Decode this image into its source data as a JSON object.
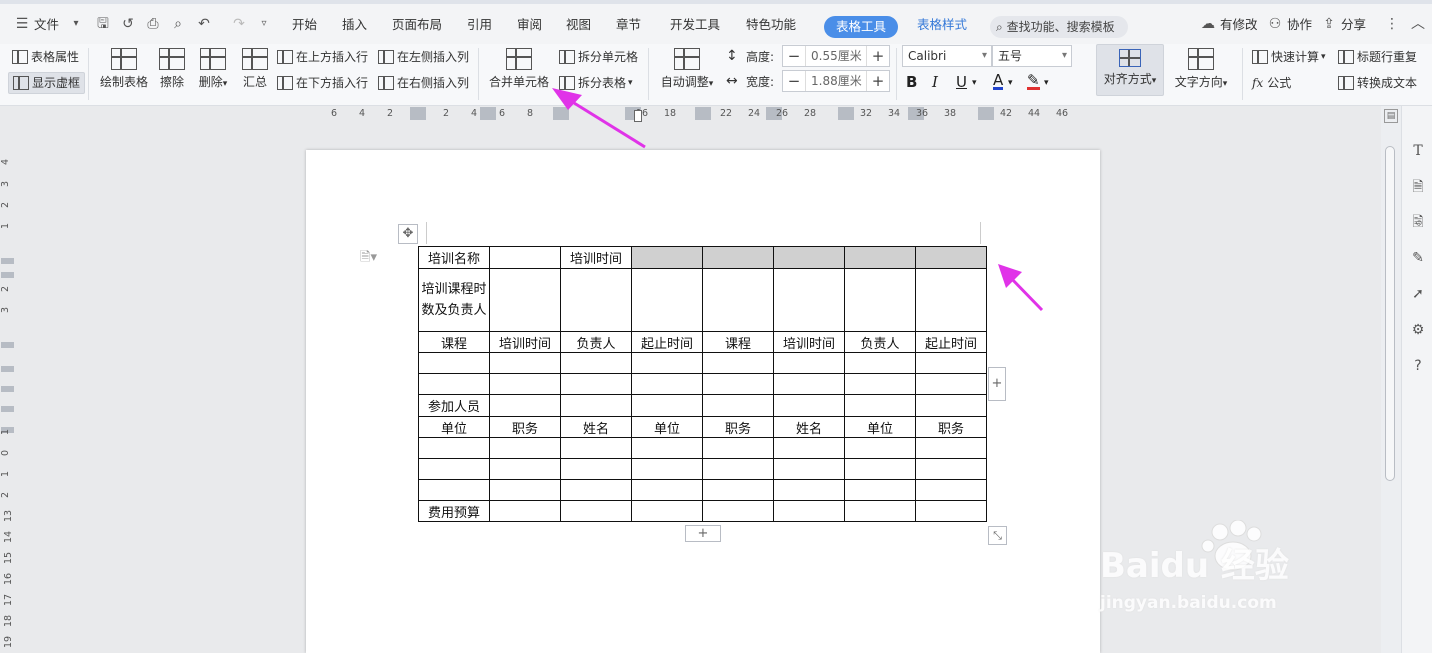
{
  "menubar": {
    "file": "文件",
    "tabs": [
      "开始",
      "插入",
      "页面布局",
      "引用",
      "审阅",
      "视图",
      "章节",
      "开发工具",
      "特色功能"
    ],
    "active_tab": "表格工具",
    "style_tab": "表格样式",
    "search": "查找功能、搜索模板",
    "modified": "有修改",
    "collab": "协作",
    "share": "分享"
  },
  "ribbon": {
    "table_props": "表格属性",
    "show_grid": "显示虚框",
    "draw_table": "绘制表格",
    "erase": "擦除",
    "delete": "删除",
    "summary": "汇总",
    "insert_above": "在上方插入行",
    "insert_below": "在下方插入行",
    "insert_left": "在左侧插入列",
    "insert_right": "在右侧插入列",
    "merge_cells": "合并单元格",
    "split_cells": "拆分单元格",
    "split_table": "拆分表格",
    "autofit": "自动调整",
    "height_label": "高度:",
    "height_value": "0.55厘米",
    "width_label": "宽度:",
    "width_value": "1.88厘米",
    "font": "Calibri",
    "font_size": "五号",
    "align": "对齐方式",
    "text_dir": "文字方向",
    "quick_calc": "快速计算",
    "repeat_header": "标题行重复",
    "formula": "公式",
    "to_text": "转换成文本"
  },
  "hruler": [
    "6",
    "4",
    "2",
    "2",
    "4",
    "6",
    "8",
    "16",
    "18",
    "22",
    "24",
    "26",
    "28",
    "32",
    "34",
    "36",
    "38",
    "42",
    "44",
    "46"
  ],
  "vruler": [
    "4",
    "3",
    "2",
    "1",
    "2",
    "3",
    "1",
    "0",
    "1",
    "2",
    "13",
    "14",
    "15",
    "16",
    "17",
    "18",
    "19"
  ],
  "table": {
    "r1": [
      "培训名称",
      "",
      "培训时间",
      "",
      "",
      "",
      "",
      ""
    ],
    "r2": [
      "培训课程时数及负责人",
      "",
      "",
      "",
      "",
      "",
      "",
      ""
    ],
    "r3": [
      "课程",
      "培训时间",
      "负责人",
      "起止时间",
      "课程",
      "培训时间",
      "负责人",
      "起止时间"
    ],
    "r6": [
      "参加人员"
    ],
    "r7": [
      "单位",
      "职务",
      "姓名",
      "单位",
      "职务",
      "姓名",
      "单位",
      "职务"
    ],
    "r11": [
      "费用预算"
    ]
  },
  "colors": {
    "accent": "#4a8ee8",
    "arrow": "#e033e8",
    "selected_cell": "#d0d0d0"
  },
  "watermark": {
    "brand": "Baidu 经验",
    "site": "jingyan.baidu.com"
  }
}
